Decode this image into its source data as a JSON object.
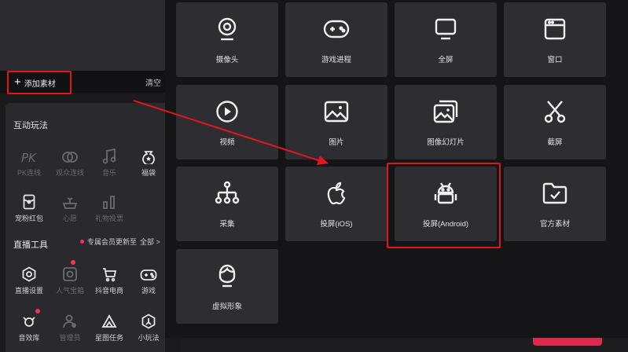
{
  "toolbar": {
    "add_material": "添加素材",
    "clear": "清空"
  },
  "interactive": {
    "title": "互动玩法",
    "items": [
      {
        "label": "PK连线",
        "icon": "pk-icon",
        "enabled": false
      },
      {
        "label": "观众连线",
        "icon": "audience-link-icon",
        "enabled": false
      },
      {
        "label": "音乐",
        "icon": "music-icon",
        "enabled": false
      },
      {
        "label": "福袋",
        "icon": "lucky-bag-icon",
        "enabled": true
      },
      {
        "label": "宠粉红包",
        "icon": "red-packet-icon",
        "enabled": true
      },
      {
        "label": "心愿",
        "icon": "wish-icon",
        "enabled": false
      },
      {
        "label": "礼物投票",
        "icon": "gift-vote-icon",
        "enabled": false
      }
    ]
  },
  "live_tools": {
    "title": "直播工具",
    "promo": "专属会员更新至",
    "all": "全部 >",
    "items": [
      {
        "label": "直播设置",
        "icon": "live-settings-icon",
        "enabled": true
      },
      {
        "label": "人气宝箱",
        "icon": "treasure-box-icon",
        "enabled": false
      },
      {
        "label": "抖音电商",
        "icon": "cart-icon",
        "enabled": true
      },
      {
        "label": "游戏",
        "icon": "game-icon",
        "enabled": true
      },
      {
        "label": "音效库",
        "icon": "sound-effect-icon",
        "enabled": true
      },
      {
        "label": "管理员",
        "icon": "admin-icon",
        "enabled": false
      },
      {
        "label": "星图任务",
        "icon": "star-task-icon",
        "enabled": true
      },
      {
        "label": "小玩法",
        "icon": "mini-game-icon",
        "enabled": true
      }
    ]
  },
  "materials": [
    {
      "label": "摄像头",
      "icon": "camera-icon"
    },
    {
      "label": "游戏进程",
      "icon": "gamepad-icon"
    },
    {
      "label": "全屏",
      "icon": "monitor-icon"
    },
    {
      "label": "窗口",
      "icon": "window-icon"
    },
    {
      "label": "视频",
      "icon": "play-icon"
    },
    {
      "label": "图片",
      "icon": "image-icon"
    },
    {
      "label": "图像幻灯片",
      "icon": "slideshow-icon"
    },
    {
      "label": "截屏",
      "icon": "scissors-icon"
    },
    {
      "label": "采集",
      "icon": "capture-icon"
    },
    {
      "label": "投屏(iOS)",
      "icon": "apple-icon"
    },
    {
      "label": "投屏(Android)",
      "icon": "android-icon"
    },
    {
      "label": "官方素材",
      "icon": "folder-check-icon"
    },
    {
      "label": "虚拟形象",
      "icon": "avatar-icon"
    }
  ],
  "highlight_color": "#e1161e",
  "accent_color": "#fe2c55"
}
